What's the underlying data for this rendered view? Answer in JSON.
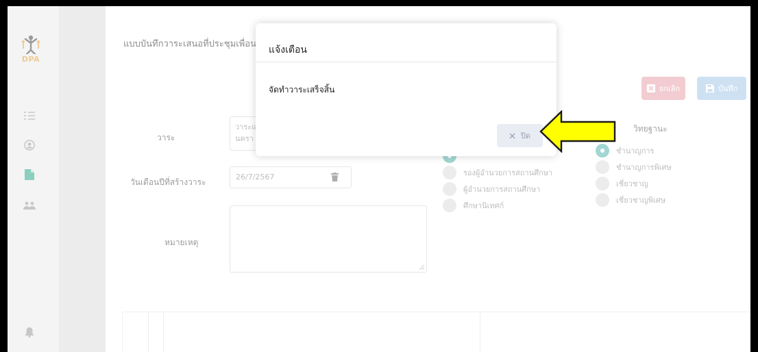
{
  "app": {
    "logo_text": "DPA"
  },
  "sidebar": {
    "icons": [
      "list-icon",
      "user-circle-icon",
      "document-icon",
      "users-icon",
      "bell-icon"
    ]
  },
  "page": {
    "title": "แบบบันทึกวาระเสนอที่ประชุมเพื่อน"
  },
  "toolbar": {
    "cancel_label": "ยกเลิก",
    "save_label": "บันทึก"
  },
  "form": {
    "agenda_label": "วาระ",
    "agenda_value_line1": "วาระแ",
    "agenda_value_line2": "นครา",
    "date_label": "วันเดือนปีที่สร้างวาระ",
    "date_value": "26/7/2567",
    "remark_label": "หมายเหตุ"
  },
  "position_group": {
    "options": [
      "รองผู้อำนวยการสถานศึกษา",
      "ผู้อำนวยการสถานศึกษา",
      "ศึกษานิเทศก์"
    ]
  },
  "academic_standing": {
    "heading": "วิทยฐานะ",
    "options": [
      "ชำนาญการ",
      "ชำนาญการพิเศษ",
      "เชี่ยวชาญ",
      "เชี่ยวชาญพิเศษ"
    ],
    "selected": "ชำนาญการ"
  },
  "modal": {
    "title": "แจ้งเตือน",
    "message": "จัดทำวาระเสร็จสิ้น",
    "close_label": "ปิด"
  },
  "annotation": {
    "arrow_color": "#ffff00"
  }
}
